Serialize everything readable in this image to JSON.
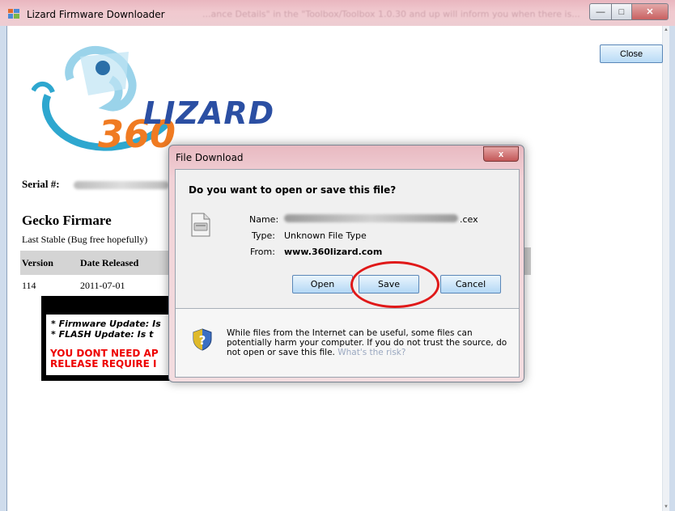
{
  "window": {
    "title": "Lizard Firmware Downloader",
    "ghost_title": "...ance Details\" in the \"Toolbox/Toolbox 1.0.30 and up will inform you when there is...",
    "close_button": "Close"
  },
  "logo": {
    "text": "LIZARD"
  },
  "serial": {
    "label": "Serial #:"
  },
  "firmware": {
    "heading": "Gecko Firmare",
    "subheading": "Last Stable (Bug free hopefully)",
    "columns": [
      "Version",
      "Date Released"
    ],
    "rows": [
      {
        "version": "114",
        "date": "2011-07-01"
      }
    ]
  },
  "banner": {
    "line1": "* Firmware Update: Is",
    "line2": "* FLASH Update:  Is t",
    "line3": "YOU DONT NEED AP",
    "line4": "RELEASE REQUIRE I"
  },
  "dialog": {
    "title": "File Download",
    "close_glyph": "x",
    "question": "Do you want to open or save this file?",
    "name_label": "Name:",
    "name_value_suffix": ".cex",
    "type_label": "Type:",
    "type_value": "Unknown File Type",
    "from_label": "From:",
    "from_value": "www.360lizard.com",
    "buttons": {
      "open": "Open",
      "save": "Save",
      "cancel": "Cancel"
    },
    "warning": "While files from the Internet can be useful, some files can potentially harm your computer. If you do not trust the source, do not open or save this file.",
    "risk_link": "What's the risk?"
  },
  "colors": {
    "annotation_circle": "#e01919",
    "accent": "#2b4fa3",
    "button_border": "#5a87b8"
  }
}
